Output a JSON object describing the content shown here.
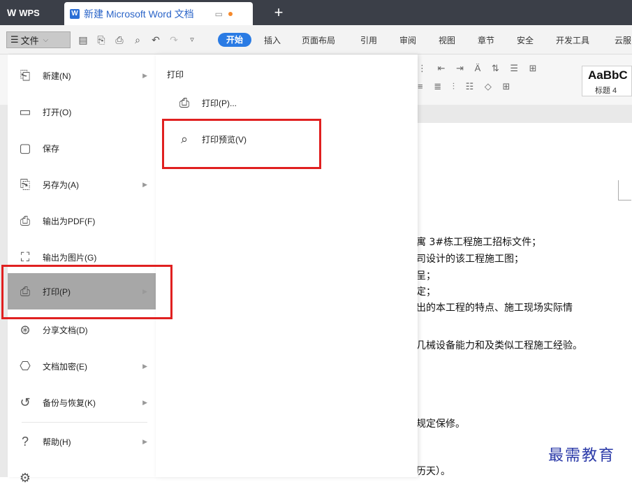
{
  "titlebar": {
    "app_tab": "WPS",
    "doc_tab_icon": "W",
    "doc_tab_title": "新建 Microsoft Word 文档",
    "new_tab_symbol": "+"
  },
  "toolbar": {
    "file_label": "文件",
    "start_label": "开始",
    "tabs": [
      "插入",
      "页面布局",
      "引用",
      "审阅",
      "视图",
      "章节",
      "安全",
      "开发工具",
      "云服"
    ]
  },
  "style_gallery": {
    "preview": "AaBbC",
    "style_name": "标题 4"
  },
  "file_menu": {
    "items": [
      {
        "label": "新建(N)",
        "icon": "new-doc-icon",
        "has_submenu": true
      },
      {
        "label": "打开(O)",
        "icon": "folder-icon",
        "has_submenu": false
      },
      {
        "label": "保存",
        "icon": "save-icon",
        "has_submenu": false
      },
      {
        "label": "另存为(A)",
        "icon": "save-as-icon",
        "has_submenu": true
      },
      {
        "label": "输出为PDF(F)",
        "icon": "pdf-icon",
        "has_submenu": false
      },
      {
        "label": "输出为图片(G)",
        "icon": "image-export-icon",
        "has_submenu": false
      },
      {
        "label": "打印(P)",
        "icon": "printer-icon",
        "has_submenu": true,
        "selected": true
      },
      {
        "label": "分享文档(D)",
        "icon": "share-icon",
        "has_submenu": false
      },
      {
        "label": "文档加密(E)",
        "icon": "encrypt-icon",
        "has_submenu": true
      },
      {
        "label": "备份与恢复(K)",
        "icon": "backup-icon",
        "has_submenu": true
      },
      {
        "label": "帮助(H)",
        "icon": "help-icon",
        "has_submenu": true
      },
      {
        "label": "",
        "icon": "options-icon",
        "has_submenu": false
      }
    ]
  },
  "print_submenu": {
    "header": "打印",
    "items": [
      {
        "label": "打印(P)...",
        "icon": "printer-icon"
      },
      {
        "label": "打印预览(V)",
        "icon": "print-preview-icon"
      }
    ]
  },
  "document_lines": [
    "寓 3#栋工程施工招标文件；",
    "司设计的该工程施工图；",
    "呈；",
    "定；",
    "出的本工程的特点、施工现场实际情",
    "几械设备能力和及类似工程施工经验。",
    "规定保修。",
    "历天）。"
  ],
  "watermark": "最需教育",
  "colors": {
    "accent": "#2a7be4",
    "highlight_box": "#e02020",
    "selected_item": "#a7a7a7"
  }
}
